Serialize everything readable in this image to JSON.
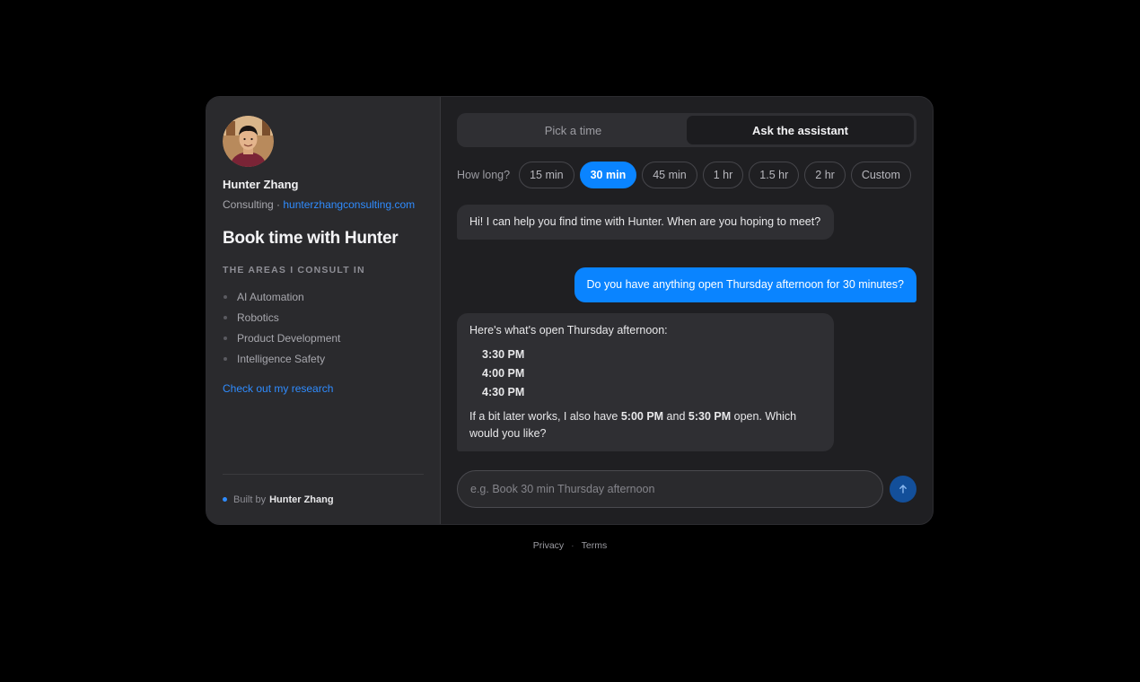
{
  "profile": {
    "name": "Hunter Zhang",
    "role": "Consulting",
    "separator": " · ",
    "website": "hunterzhangconsulting.com"
  },
  "sidebar": {
    "title": "Book time with Hunter",
    "areas_heading": "THE AREAS I CONSULT IN",
    "areas": [
      "AI Automation",
      "Robotics",
      "Product Development",
      "Intelligence Safety"
    ],
    "research_link": "Check out my research",
    "built_by_prefix": "Built by",
    "built_by_name": "Hunter Zhang"
  },
  "tabs": [
    {
      "label": "Pick a time",
      "active": false
    },
    {
      "label": "Ask the assistant",
      "active": true
    }
  ],
  "duration": {
    "label": "How long?",
    "options": [
      "15 min",
      "30 min",
      "45 min",
      "1 hr",
      "1.5 hr",
      "2 hr",
      "Custom"
    ],
    "selected": "30 min"
  },
  "messages": {
    "m1": "Hi! I can help you find time with Hunter. When are you hoping to meet?",
    "m2": "Do you have anything open Thursday afternoon for 30 minutes?",
    "m3_intro": "Here's what's open Thursday afternoon:",
    "m3_slots": [
      "3:30 PM",
      "4:00 PM",
      "4:30 PM"
    ],
    "m3_later_a": "If a bit later works, I also have ",
    "m3_later_t1": "5:00 PM",
    "m3_later_b": " and ",
    "m3_later_t2": "5:30 PM",
    "m3_later_c": " open. Which would you like?"
  },
  "composer": {
    "placeholder": "e.g. Book 30 min Thursday afternoon",
    "send_icon": "arrow-up-icon"
  },
  "footer": {
    "privacy": "Privacy",
    "separator": "·",
    "terms": "Terms"
  },
  "colors": {
    "accent": "#0a84ff",
    "link": "#2f8cff",
    "background": "#000000",
    "panel": "#1f1f22",
    "sidebar": "#2a2a2d"
  }
}
